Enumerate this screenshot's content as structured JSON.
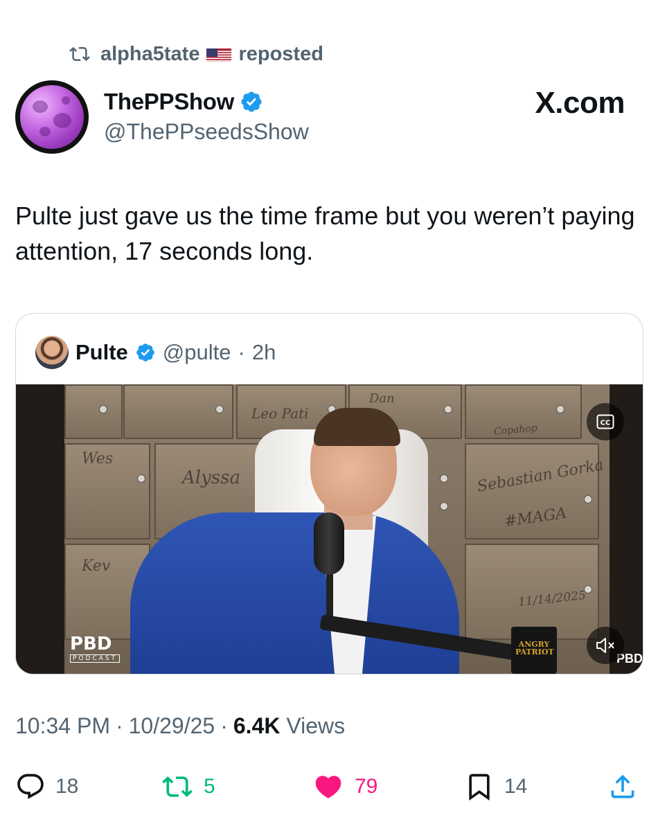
{
  "repost": {
    "user": "alpha5tate",
    "label": "reposted"
  },
  "author": {
    "display_name": "ThePPShow",
    "handle": "@ThePPseedsShow"
  },
  "brand": "X.com",
  "post": {
    "text": "Pulte just gave us the time frame but you weren’t paying attention, 17 seconds long."
  },
  "quoted": {
    "display_name": "Pulte",
    "handle": "@pulte",
    "separator": "·",
    "age": "2h",
    "video": {
      "watermark": "PBD",
      "watermark_sub": "PODCAST",
      "watermark_corner": "PBD",
      "mug_text": "ANGRY PATRIOT",
      "captions_button": "CC",
      "scribbles": [
        "Sebastian Gorka",
        "#MAGA",
        "11/14/2025",
        "Copahop"
      ]
    }
  },
  "meta": {
    "time": "10:34 PM",
    "date": "10/29/25",
    "views_count": "6.4K",
    "views_label": "Views",
    "dot": "·"
  },
  "actions": {
    "replies": "18",
    "reposts": "5",
    "likes": "79",
    "bookmarks": "14"
  },
  "colors": {
    "verified": "#1d9bf0",
    "repost": "#00ba7c",
    "like": "#f91880",
    "muted": "#536471"
  }
}
